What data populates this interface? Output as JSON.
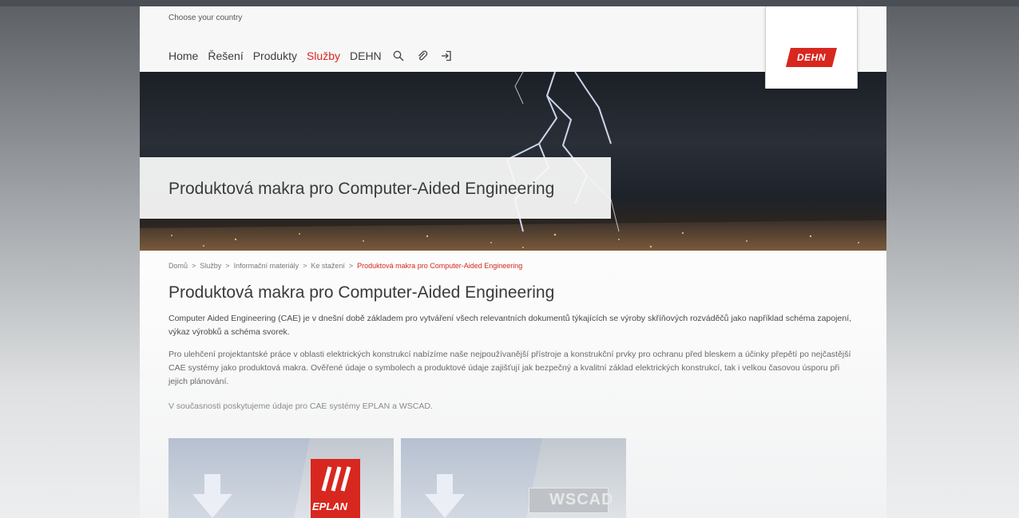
{
  "header": {
    "country_selector": "Choose your country",
    "nav": [
      "Home",
      "Řešení",
      "Produkty",
      "Služby",
      "DEHN"
    ],
    "active_nav_index": 3,
    "icons": [
      "search-icon",
      "paperclip-icon",
      "login-icon"
    ],
    "logo_text": "DEHN"
  },
  "hero": {
    "title": "Produktová makra pro Computer-Aided Engineering"
  },
  "breadcrumb": {
    "items": [
      "Domů",
      "Služby",
      "Informační materiály",
      "Ke stažení"
    ],
    "current": "Produktová makra pro Computer-Aided Engineering",
    "separator": ">"
  },
  "content": {
    "heading": "Produktová makra pro Computer-Aided Engineering",
    "paragraph1": "Computer Aided Engineering (CAE) je v dnešní době základem pro vytváření všech relevantních dokumentů týkajících se výroby skříňových rozváděčů jako například schéma zapojení, výkaz výrobků a schéma svorek.",
    "paragraph2": "Pro ulehčení projektantské práce v oblasti elektrických konstrukcí nabízíme naše nejpoužívanější přístroje a konstrukční prvky pro ochranu před bleskem a účinky přepětí po nejčastější CAE systémy jako produktová makra. Ověřené údaje o symbolech a produktové údaje zajišťují jak bezpečný a kvalitní základ elektrických konstrukcí, tak i velkou časovou úsporu při jejich plánování.",
    "paragraph3": "V současnosti poskytujeme údaje pro CAE systémy EPLAN a WSCAD."
  },
  "tiles": [
    {
      "brand": "EPLAN",
      "icon": "download-arrow-icon"
    },
    {
      "brand": "WSCAD",
      "icon": "download-arrow-icon"
    }
  ],
  "colors": {
    "accent": "#d8271f",
    "text": "#3a3a3a"
  }
}
